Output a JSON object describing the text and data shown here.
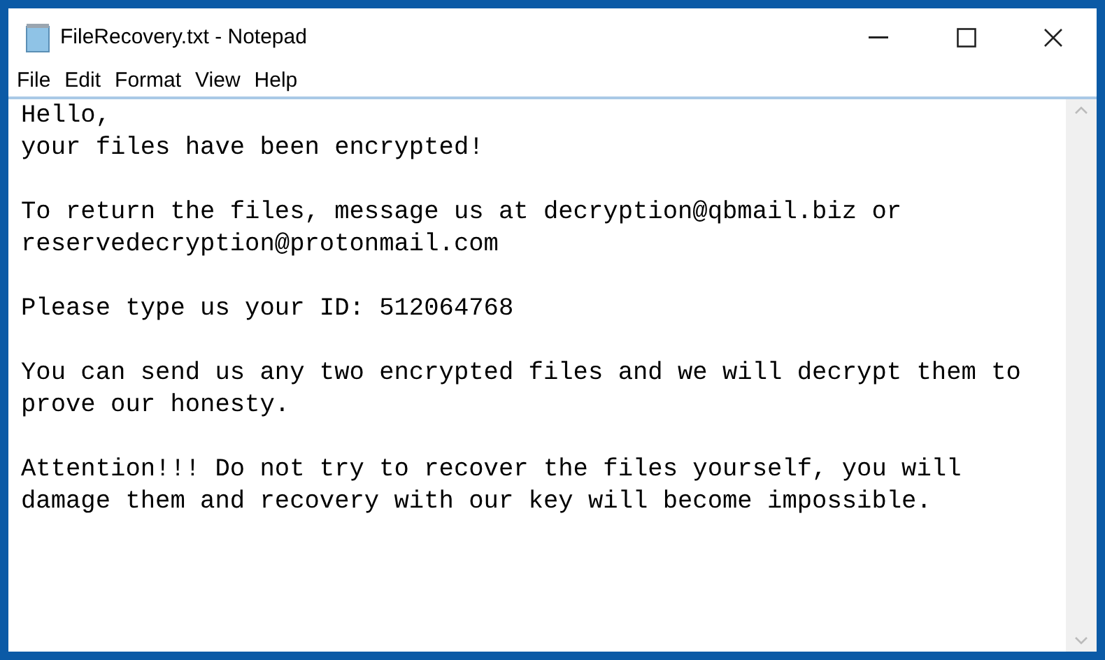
{
  "window": {
    "title": "FileRecovery.txt - Notepad"
  },
  "menu": [
    "File",
    "Edit",
    "Format",
    "View",
    "Help"
  ],
  "document": {
    "paragraphs": [
      [
        "Hello,",
        "your files have been encrypted!"
      ],
      [
        "To return the files, message us at decryption@qbmail.biz or",
        "reservedecryption@protonmail.com"
      ],
      [
        "Please type us your ID: 512064768"
      ],
      [
        "You can send us any two encrypted files and we will decrypt them to",
        "prove our honesty."
      ],
      [
        "Attention!!! Do not try to recover the files yourself, you will",
        "damage them and recovery with our key will become impossible."
      ]
    ]
  }
}
